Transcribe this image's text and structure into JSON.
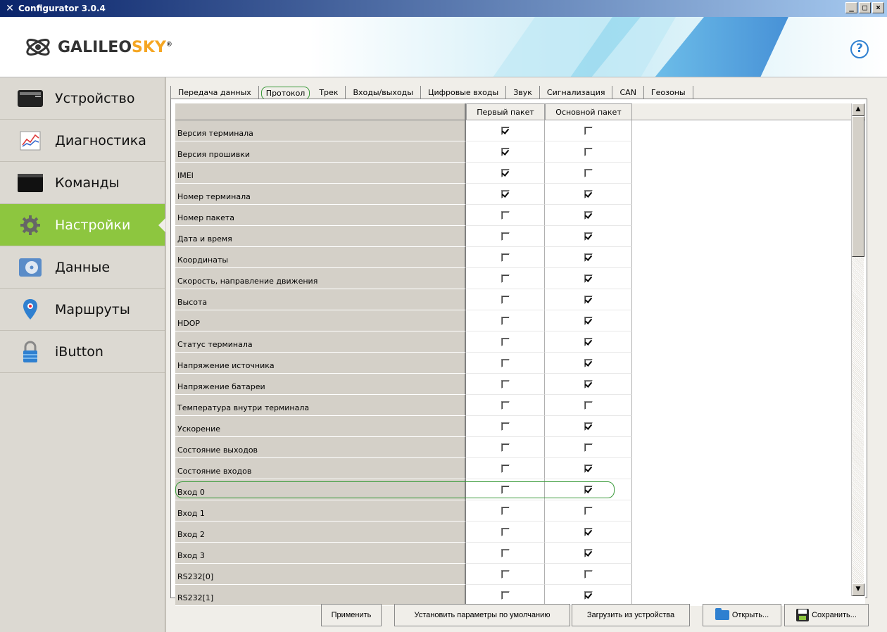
{
  "window": {
    "title": "Configurator 3.0.4",
    "controls": [
      "_",
      "□",
      "×"
    ]
  },
  "header": {
    "logo_text_main": "GALILEO",
    "logo_text_accent": "SKY",
    "logo_mark": "®",
    "help": "?"
  },
  "sidebar": {
    "items": [
      {
        "label": "Устройство",
        "icon": "device-icon"
      },
      {
        "label": "Диагностика",
        "icon": "chart-icon"
      },
      {
        "label": "Команды",
        "icon": "terminal-icon"
      },
      {
        "label": "Настройки",
        "icon": "gear-icon",
        "active": true
      },
      {
        "label": "Данные",
        "icon": "disk-icon"
      },
      {
        "label": "Маршруты",
        "icon": "map-pin-icon"
      },
      {
        "label": "iButton",
        "icon": "lock-icon"
      }
    ]
  },
  "tabs": [
    "Передача данных",
    "Протокол",
    "Трек",
    "Входы/выходы",
    "Цифровые входы",
    "Звук",
    "Сигнализация",
    "CAN",
    "Геозоны"
  ],
  "active_tab": "Протокол",
  "grid": {
    "columns": [
      "Первый пакет",
      "Основной пакет"
    ],
    "rows": [
      {
        "name": "Версия терминала",
        "first": true,
        "main": false
      },
      {
        "name": "Версия прошивки",
        "first": true,
        "main": false
      },
      {
        "name": "IMEI",
        "first": true,
        "main": false
      },
      {
        "name": "Номер терминала",
        "first": true,
        "main": true
      },
      {
        "name": "Номер пакета",
        "first": false,
        "main": true
      },
      {
        "name": "Дата и время",
        "first": false,
        "main": true
      },
      {
        "name": "Координаты",
        "first": false,
        "main": true
      },
      {
        "name": "Скорость, направление движения",
        "first": false,
        "main": true
      },
      {
        "name": "Высота",
        "first": false,
        "main": true
      },
      {
        "name": "HDOP",
        "first": false,
        "main": true
      },
      {
        "name": "Статус терминала",
        "first": false,
        "main": true
      },
      {
        "name": "Напряжение источника",
        "first": false,
        "main": true
      },
      {
        "name": "Напряжение батареи",
        "first": false,
        "main": true
      },
      {
        "name": "Температура внутри терминала",
        "first": false,
        "main": false
      },
      {
        "name": "Ускорение",
        "first": false,
        "main": true
      },
      {
        "name": "Состояние выходов",
        "first": false,
        "main": false
      },
      {
        "name": "Состояние входов",
        "first": false,
        "main": true
      },
      {
        "name": "Вход 0",
        "first": false,
        "main": true,
        "highlighted": true
      },
      {
        "name": "Вход 1",
        "first": false,
        "main": false
      },
      {
        "name": "Вход 2",
        "first": false,
        "main": true
      },
      {
        "name": "Вход 3",
        "first": false,
        "main": true
      },
      {
        "name": "RS232[0]",
        "first": false,
        "main": false
      },
      {
        "name": "RS232[1]",
        "first": false,
        "main": true
      }
    ]
  },
  "buttons": {
    "apply": "Применить",
    "defaults": "Установить параметры по умолчанию",
    "load": "Загрузить из устройства",
    "open": "Открыть...",
    "save": "Сохранить..."
  }
}
